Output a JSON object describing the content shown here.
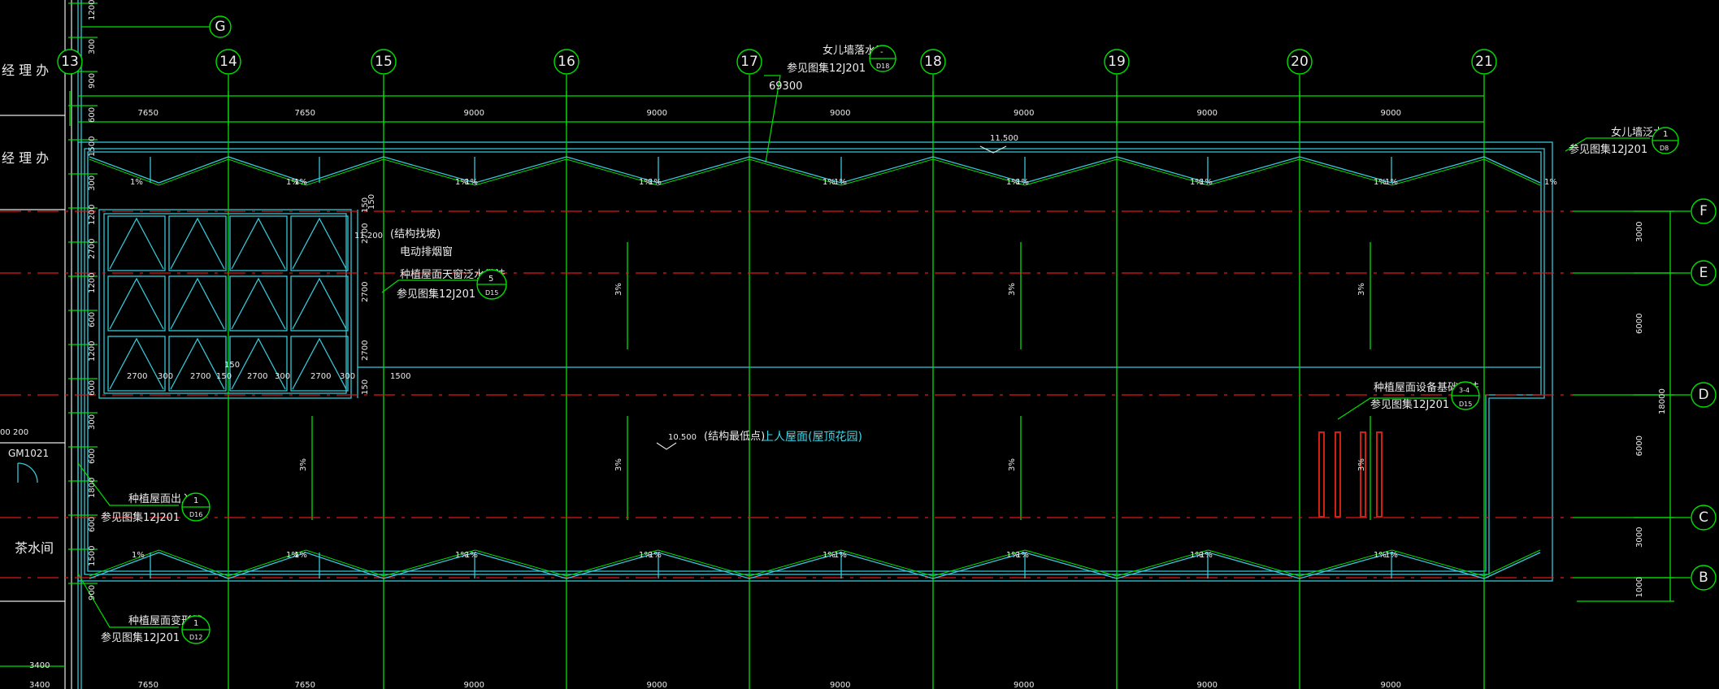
{
  "grid_axes": {
    "columns": [
      "13",
      "14",
      "15",
      "16",
      "17",
      "18",
      "19",
      "20",
      "21"
    ],
    "rows": [
      "G",
      "F",
      "E",
      "D",
      "C",
      "B"
    ]
  },
  "dimensions": {
    "overall": "69300",
    "top_spans": [
      "7650",
      "7650",
      "9000",
      "9000",
      "9000",
      "9000",
      "9000",
      "9000"
    ],
    "bottom_spans": [
      "7650",
      "7650",
      "9000",
      "9000",
      "9000",
      "9000",
      "9000",
      "9000"
    ],
    "right_spans": [
      "3000",
      "6000",
      "6000",
      "3000",
      "1000"
    ],
    "right_total": "18000",
    "left_vertical": [
      "1200",
      "300",
      "900",
      "600",
      "1500",
      "300",
      "1200",
      "2700",
      "1200",
      "600",
      "1200",
      "600",
      "300",
      "600",
      "1800",
      "600",
      "1500",
      "900"
    ],
    "bottom_left": [
      "3400",
      "3400"
    ],
    "skylight_widths": [
      "2700",
      "300",
      "2700",
      "150",
      "2700",
      "300",
      "2700",
      "300"
    ],
    "skylight_heights": [
      "150",
      "2700",
      "2700",
      "2700",
      "150"
    ],
    "misc": [
      "150",
      "150",
      "1500",
      "200",
      "00"
    ]
  },
  "elevations": {
    "roof_top": "11.500",
    "skylight": "11.200",
    "low_point": "10.500"
  },
  "slopes": {
    "gutter": "1%",
    "roof": "3%"
  },
  "labels": {
    "structural_slope": "(结构找坡)",
    "smoke_window": "电动排烟窗",
    "lowest_point": "(结构最低点)",
    "roof_use": "上人屋面(屋顶花园)"
  },
  "rooms": [
    "经 理 办",
    "经 理 办",
    "茶水间"
  ],
  "doors": [
    "GM1021"
  ],
  "callouts": [
    {
      "title": "女儿墙落水口",
      "ref": "参见图集12J201",
      "num": "-",
      "sheet": "D18"
    },
    {
      "title": "女儿墙泛水",
      "ref": "参见图集12J201",
      "num": "1",
      "sheet": "D8"
    },
    {
      "title": "种植屋面天窗泛水做法",
      "ref": "参见图集12J201",
      "num": "5",
      "sheet": "D15"
    },
    {
      "title": "种植屋面设备基础做法",
      "ref": "参见图集12J201",
      "num": "3-4",
      "sheet": "D15"
    },
    {
      "title": "种植屋面出入口",
      "ref": "参见图集12J201",
      "num": "1",
      "sheet": "D16"
    },
    {
      "title": "种植屋面变形缝",
      "ref": "参见图集12J201",
      "num": "1",
      "sheet": "D12"
    }
  ],
  "colors": {
    "background": "#000000",
    "grid_line": "#00e000",
    "axis_line": "#e01818",
    "outline": "#35c8d8",
    "text": "#ececec",
    "equipment": "#d02010"
  }
}
